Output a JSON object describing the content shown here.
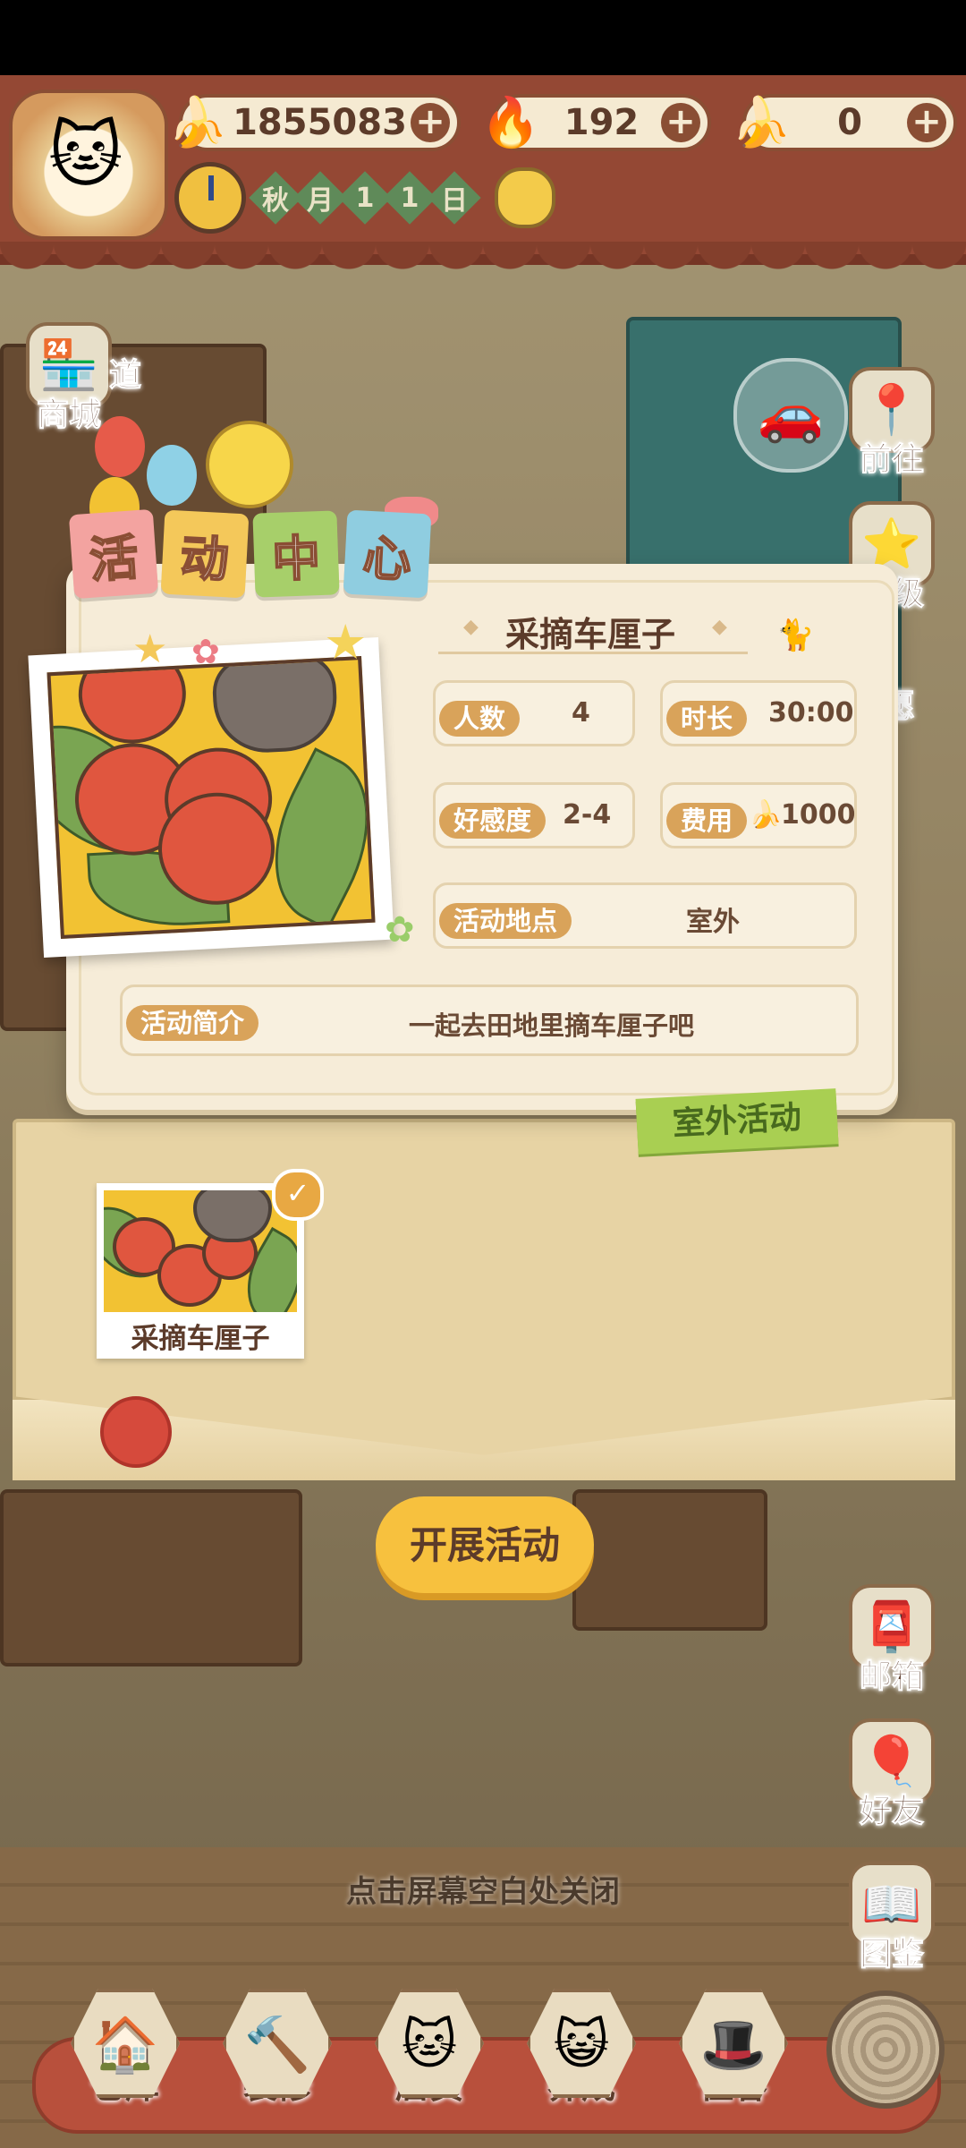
{
  "currency": {
    "bananas": "1855083",
    "flames": "192",
    "blue_bananas": "0"
  },
  "date": {
    "chars": [
      "秋",
      "月",
      "1",
      "1",
      "日"
    ]
  },
  "left_menu": [
    {
      "label": "商城",
      "icon": "shop-icon"
    },
    {
      "label": "道",
      "icon": "road-icon"
    }
  ],
  "right_menu": [
    {
      "label": "前往",
      "icon": "map-pin-icon"
    },
    {
      "label": "等级",
      "icon": "level-icon"
    },
    {
      "label": "愿",
      "icon": "wish-icon"
    }
  ],
  "activity_center": {
    "tabs": [
      "活",
      "动",
      "中",
      "心"
    ],
    "colors": [
      "#f3a3a0",
      "#f4c85a",
      "#a7cf6a",
      "#8fcde0"
    ],
    "title": "采摘车厘子",
    "people_label": "人数",
    "people_value": "4",
    "duration_label": "时长",
    "duration_value": "30:00",
    "affinity_label": "好感度",
    "affinity_value": "2-4",
    "cost_label": "费用",
    "cost_value": "1000",
    "location_label": "活动地点",
    "location_value": "室外",
    "intro_label": "活动简介",
    "intro_value": "一起去田地里摘车厘子吧",
    "tag": "室外活动"
  },
  "selected_card": {
    "label": "采摘车厘子"
  },
  "start_button": "开展活动",
  "close_hint": "点击屏幕空白处关闭",
  "side_right_lower": [
    {
      "label": "邮箱",
      "icon": "mailbox-icon"
    },
    {
      "label": "好友",
      "icon": "friends-icon"
    },
    {
      "label": "图鉴",
      "icon": "book-icon"
    }
  ],
  "bottom_nav": [
    {
      "label": "仓库",
      "icon": "warehouse-icon"
    },
    {
      "label": "装修",
      "icon": "hammer-icon"
    },
    {
      "label": "店员",
      "icon": "staff-icon"
    },
    {
      "label": "养成",
      "icon": "cat-icon"
    },
    {
      "label": "住客",
      "icon": "guest-icon"
    }
  ]
}
